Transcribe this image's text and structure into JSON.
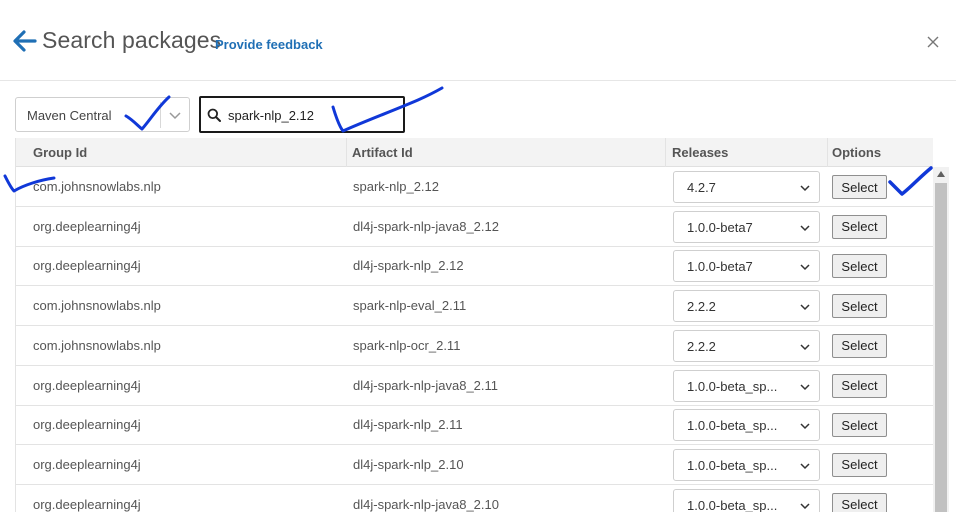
{
  "header": {
    "title": "Search packages",
    "feedback_label": "Provide feedback"
  },
  "filters": {
    "repository": "Maven Central",
    "search_value": "spark-nlp_2.12"
  },
  "table": {
    "columns": [
      "Group Id",
      "Artifact Id",
      "Releases",
      "Options"
    ],
    "rows": [
      {
        "group": "com.johnsnowlabs.nlp",
        "artifact": "spark-nlp_2.12",
        "release": "4.2.7",
        "option": "Select"
      },
      {
        "group": "org.deeplearning4j",
        "artifact": "dl4j-spark-nlp-java8_2.12",
        "release": "1.0.0-beta7",
        "option": "Select"
      },
      {
        "group": "org.deeplearning4j",
        "artifact": "dl4j-spark-nlp_2.12",
        "release": "1.0.0-beta7",
        "option": "Select"
      },
      {
        "group": "com.johnsnowlabs.nlp",
        "artifact": "spark-nlp-eval_2.11",
        "release": "2.2.2",
        "option": "Select"
      },
      {
        "group": "com.johnsnowlabs.nlp",
        "artifact": "spark-nlp-ocr_2.11",
        "release": "2.2.2",
        "option": "Select"
      },
      {
        "group": "org.deeplearning4j",
        "artifact": "dl4j-spark-nlp-java8_2.11",
        "release": "1.0.0-beta_sp...",
        "option": "Select"
      },
      {
        "group": "org.deeplearning4j",
        "artifact": "dl4j-spark-nlp_2.11",
        "release": "1.0.0-beta_sp...",
        "option": "Select"
      },
      {
        "group": "org.deeplearning4j",
        "artifact": "dl4j-spark-nlp_2.10",
        "release": "1.0.0-beta_sp...",
        "option": "Select"
      },
      {
        "group": "org.deeplearning4j",
        "artifact": "dl4j-spark-nlp-java8_2.10",
        "release": "1.0.0-beta_sp...",
        "option": "Select"
      }
    ]
  },
  "icons": {
    "back": "arrow-left-icon",
    "close": "close-icon",
    "search": "search-icon",
    "chevron": "chevron-down-icon"
  },
  "colors": {
    "accent": "#1f6fb5",
    "annotation": "#1038d8"
  }
}
